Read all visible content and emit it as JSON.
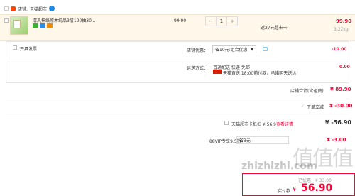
{
  "store": {
    "prefix": "店铺:",
    "name": "天猫超市"
  },
  "product": {
    "title": "清风抹纸原木纯品3层100抽30...",
    "unit_price": "99.90",
    "quantity": "1",
    "minus": "−",
    "plus": "+",
    "points_note": "返27元超市卡",
    "subtotal": "99.90",
    "weight": "3.22kg"
  },
  "invoice": {
    "label": "开具发票"
  },
  "store_discount": {
    "label": "店铺优惠：",
    "selected": "省10元:组合优惠",
    "amount": "-10.00"
  },
  "shipping": {
    "label": "运送方式：",
    "method": "普通配送 快递 免邮",
    "tmall_note": "天猫直送  18:00前付款，承诺明天送达",
    "amount": "0.00"
  },
  "store_total": {
    "label": "店铺合计(含运费)",
    "amount": "¥ 89.90"
  },
  "instant": {
    "label": "下单立减",
    "amount": "¥ -30.00"
  },
  "card": {
    "label": "天猫超市卡抵扣 ¥ 56.9",
    "link": "查看详情",
    "amount": "¥ -56.90"
  },
  "vip": {
    "label": "88VIP专享9.5折",
    "selected": "省3元",
    "amount": "¥ -3.00"
  },
  "final": {
    "label": "实付款：",
    "currency": "¥",
    "amount": "56.90",
    "saved": "已优惠：¥ 33.00"
  },
  "watermark": {
    "glyphs": "值值值",
    "domain": "zhizhizhi.com"
  },
  "colors": {
    "accent": "#ff0036",
    "product_bg": "#fff8ea",
    "link": "#ff0036"
  }
}
